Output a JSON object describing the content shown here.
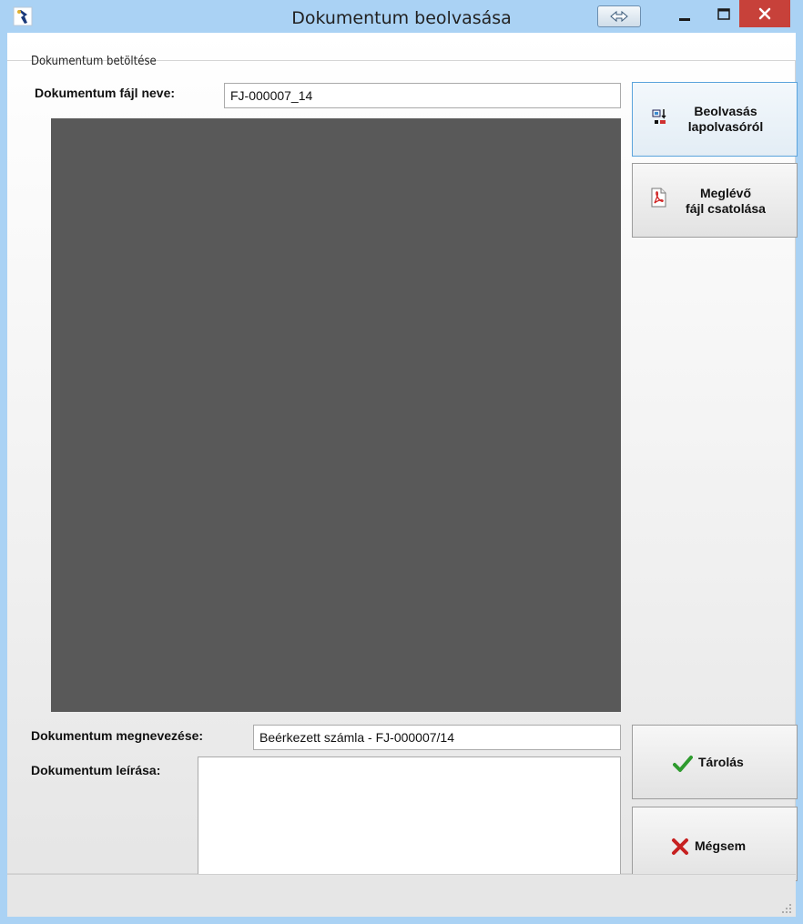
{
  "window": {
    "title": "Dokumentum beolvasása"
  },
  "group": {
    "label": "Dokumentum betöltése"
  },
  "filename": {
    "label": "Dokumentum fájl neve:",
    "value": "FJ-000007_14"
  },
  "buttons": {
    "scan_line1": "Beolvasás",
    "scan_line2": "lapolvasóról",
    "attach_line1": "Meglévő",
    "attach_line2": "fájl csatolása",
    "save": "Tárolás",
    "cancel": "Mégsem"
  },
  "doc_name": {
    "label": "Dokumentum megnevezése:",
    "value": "Beérkezett számla - FJ-000007/14"
  },
  "doc_desc": {
    "label": "Dokumentum leírása:",
    "value": ""
  },
  "colors": {
    "titlebar": "#aad2f4",
    "close": "#c7413a",
    "preview": "#595959",
    "save_icon": "#2e9b2e",
    "cancel_icon": "#c62020"
  },
  "icons": [
    "app-icon",
    "snap-icon",
    "minimize-icon",
    "maximize-icon",
    "close-icon",
    "scanner-icon",
    "pdf-icon",
    "checkmark-icon",
    "x-icon",
    "resize-grip-icon"
  ]
}
